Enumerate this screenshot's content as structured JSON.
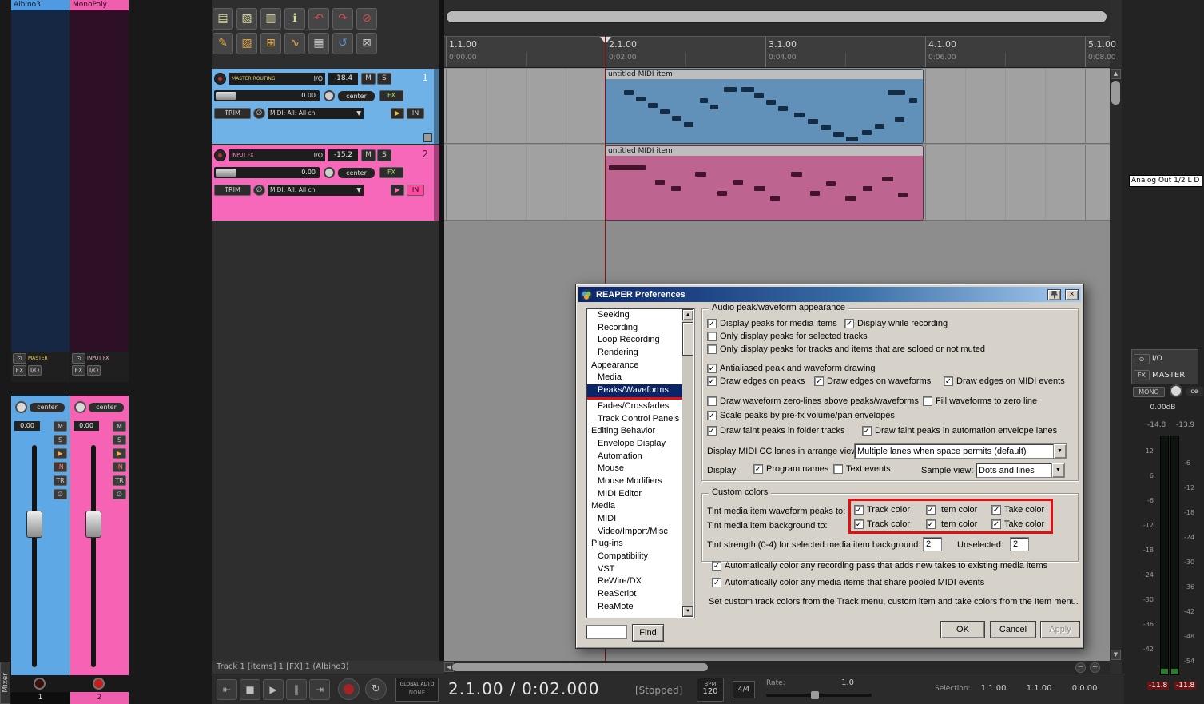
{
  "ui": {
    "mute": "M",
    "solo": "S",
    "fx": "FX",
    "io": "I/O",
    "trim": "TRIM",
    "in": "IN",
    "tr": "TR",
    "phase": "∅",
    "power": "⊙",
    "play": "▶",
    "mono": "MONO",
    "master": "MASTER",
    "mixer_tab": "Mixer",
    "up": "▲",
    "down": "▼",
    "left": "◀",
    "dd": "▼",
    "close": "×",
    "repeat": "↻",
    "zoom_in": "+",
    "zoom_out": "−"
  },
  "mixer": {
    "channels": [
      {
        "name": "Albino3",
        "number": "1",
        "volume": "0.00",
        "pan": "center",
        "route": "MASTER"
      },
      {
        "name": "MonoPoly",
        "number": "2",
        "volume": "0.00",
        "pan": "center",
        "route": "INPUT FX"
      }
    ]
  },
  "toolbar": {
    "row1": [
      {
        "name": "new-project-icon",
        "glyph": "▤",
        "color": "#d8d8a0"
      },
      {
        "name": "open-project-icon",
        "glyph": "▧",
        "color": "#d8d8a0"
      },
      {
        "name": "save-project-icon",
        "glyph": "▥",
        "color": "#d8d8a0"
      },
      {
        "name": "project-settings-icon",
        "glyph": "ℹ",
        "color": "#d8d8a0"
      },
      {
        "name": "undo-icon",
        "glyph": "↶",
        "color": "#d05050"
      },
      {
        "name": "redo-icon",
        "glyph": "↷",
        "color": "#d05050"
      },
      {
        "name": "clear-icon",
        "glyph": "⊘",
        "color": "#d05050"
      }
    ],
    "row2": [
      {
        "name": "pencil-draw-icon",
        "glyph": "✎",
        "color": "#e0a840"
      },
      {
        "name": "crossfade-icon",
        "glyph": "▨",
        "color": "#e0a840"
      },
      {
        "name": "grouping-icon",
        "glyph": "⊞",
        "color": "#e0a840"
      },
      {
        "name": "envelope-icon",
        "glyph": "∿",
        "color": "#e0a840"
      },
      {
        "name": "grid-icon",
        "glyph": "▦",
        "color": "#c8c8c8"
      },
      {
        "name": "undo-history-icon",
        "glyph": "↺",
        "color": "#6090d0"
      },
      {
        "name": "lock-icon",
        "glyph": "⊠",
        "color": "#c8c8c8"
      }
    ]
  },
  "tcp": {
    "tracks": [
      {
        "number": "1",
        "route_label": "MASTER ROUTING",
        "peak": "-18.4",
        "volume": "0.00",
        "pan": "center",
        "midi_input": "MIDI: All: All ch"
      },
      {
        "number": "2",
        "route_label": "INPUT FX",
        "peak": "-15.2",
        "volume": "0.00",
        "pan": "center",
        "midi_input": "MIDI: All: All ch"
      }
    ]
  },
  "ruler": {
    "marks": [
      {
        "bar": "1.1.00",
        "time": "0:00.00"
      },
      {
        "bar": "2.1.00",
        "time": "0:02.00"
      },
      {
        "bar": "3.1.00",
        "time": "0:04.00"
      },
      {
        "bar": "4.1.00",
        "time": "0:06.00"
      },
      {
        "bar": "5.1.00",
        "time": "0:08.00"
      }
    ]
  },
  "arrange": {
    "items": [
      {
        "label": "untitled MIDI item",
        "notes": [
          [
            23,
            14,
            12
          ],
          [
            38,
            22,
            12
          ],
          [
            53,
            30,
            12
          ],
          [
            68,
            38,
            12
          ],
          [
            83,
            46,
            12
          ],
          [
            98,
            54,
            12
          ],
          [
            118,
            24,
            10
          ],
          [
            131,
            32,
            10
          ],
          [
            148,
            10,
            16
          ],
          [
            170,
            10,
            16
          ],
          [
            186,
            18,
            12
          ],
          [
            201,
            26,
            12
          ],
          [
            216,
            34,
            12
          ],
          [
            236,
            42,
            13
          ],
          [
            253,
            50,
            13
          ],
          [
            269,
            58,
            13
          ],
          [
            285,
            66,
            13
          ],
          [
            301,
            72,
            15
          ],
          [
            321,
            64,
            12
          ],
          [
            337,
            56,
            12
          ],
          [
            353,
            14,
            22
          ],
          [
            362,
            48,
            12
          ],
          [
            380,
            24,
            10
          ]
        ]
      },
      {
        "label": "untitled MIDI item",
        "notes": [
          [
            4,
            12,
            46
          ],
          [
            62,
            30,
            12
          ],
          [
            82,
            38,
            12
          ],
          [
            112,
            20,
            14
          ],
          [
            140,
            44,
            12
          ],
          [
            160,
            30,
            12
          ],
          [
            186,
            38,
            14
          ],
          [
            206,
            50,
            12
          ],
          [
            232,
            20,
            14
          ],
          [
            256,
            44,
            12
          ],
          [
            276,
            32,
            12
          ],
          [
            300,
            50,
            14
          ],
          [
            322,
            38,
            12
          ],
          [
            346,
            26,
            14
          ],
          [
            366,
            46,
            12
          ]
        ]
      }
    ]
  },
  "status_bar": {
    "text": "Track 1 [items] 1 [FX] 1 (Albino3)"
  },
  "preferences": {
    "title": "REAPER Preferences",
    "tree": [
      {
        "label": "Seeking",
        "indent": 1
      },
      {
        "label": "Recording",
        "indent": 1
      },
      {
        "label": "Loop Recording",
        "indent": 1
      },
      {
        "label": "Rendering",
        "indent": 1
      },
      {
        "label": "Appearance",
        "indent": 0
      },
      {
        "label": "Media",
        "indent": 1
      },
      {
        "label": "Peaks/Waveforms",
        "indent": 1,
        "selected": true,
        "underlined": true
      },
      {
        "label": "Fades/Crossfades",
        "indent": 1
      },
      {
        "label": "Track Control Panels",
        "indent": 1
      },
      {
        "label": "Editing Behavior",
        "indent": 0
      },
      {
        "label": "Envelope Display",
        "indent": 1
      },
      {
        "label": "Automation",
        "indent": 1
      },
      {
        "label": "Mouse",
        "indent": 1
      },
      {
        "label": "Mouse Modifiers",
        "indent": 1
      },
      {
        "label": "MIDI Editor",
        "indent": 1
      },
      {
        "label": "Media",
        "indent": 0
      },
      {
        "label": "MIDI",
        "indent": 1
      },
      {
        "label": "Video/Import/Misc",
        "indent": 1
      },
      {
        "label": "Plug-ins",
        "indent": 0
      },
      {
        "label": "Compatibility",
        "indent": 1
      },
      {
        "label": "VST",
        "indent": 1
      },
      {
        "label": "ReWire/DX",
        "indent": 1
      },
      {
        "label": "ReaScript",
        "indent": 1
      },
      {
        "label": "ReaMote",
        "indent": 1
      }
    ],
    "find_label": "Find",
    "find_value": "",
    "appearance": {
      "title": "Audio peak/waveform appearance",
      "cb_display_peaks": {
        "label": "Display peaks for media items",
        "checked": true
      },
      "cb_display_while_recording": {
        "label": "Display while recording",
        "checked": true
      },
      "cb_only_selected": {
        "label": "Only display peaks for selected tracks",
        "checked": false
      },
      "cb_only_soloed": {
        "label": "Only display peaks for tracks and items that are soloed or not muted",
        "checked": false
      },
      "cb_antialiased": {
        "label": "Antialiased peak and waveform drawing",
        "checked": true
      },
      "cb_edges_peaks": {
        "label": "Draw edges on peaks",
        "checked": true
      },
      "cb_edges_waveforms": {
        "label": "Draw edges on waveforms",
        "checked": true
      },
      "cb_edges_midi": {
        "label": "Draw edges on MIDI events",
        "checked": true
      },
      "cb_zero_lines": {
        "label": "Draw waveform zero-lines above peaks/waveforms",
        "checked": false
      },
      "cb_fill_zero": {
        "label": "Fill waveforms to zero line",
        "checked": false
      },
      "cb_scale_prefx": {
        "label": "Scale peaks by pre-fx volume/pan envelopes",
        "checked": true
      },
      "cb_faint_folder": {
        "label": "Draw faint peaks in folder tracks",
        "checked": true
      },
      "cb_faint_envelope": {
        "label": "Draw faint peaks in automation envelope lanes",
        "checked": true
      },
      "midi_cc_label": "Display MIDI CC lanes in arrange view:",
      "midi_cc_value": "Multiple lanes when space permits (default)",
      "display_label": "Display",
      "cb_program_names": {
        "label": "Program names",
        "checked": true
      },
      "cb_text_events": {
        "label": "Text events",
        "checked": false
      },
      "sample_view_label": "Sample view:",
      "sample_view_value": "Dots and lines"
    },
    "custom_colors": {
      "title": "Custom colors",
      "tint_peaks_label": "Tint media item waveform peaks to:",
      "tint_bg_label": "Tint media item background to:",
      "peaks_track": {
        "label": "Track color",
        "checked": true
      },
      "peaks_item": {
        "label": "Item color",
        "checked": true
      },
      "peaks_take": {
        "label": "Take color",
        "checked": true
      },
      "bg_track": {
        "label": "Track color",
        "checked": true
      },
      "bg_item": {
        "label": "Item color",
        "checked": true
      },
      "bg_take": {
        "label": "Take color",
        "checked": true
      },
      "strength_label": "Tint strength (0-4) for selected media item background:",
      "strength_value": "2",
      "unselected_label": "Unselected:",
      "unselected_value": "2"
    },
    "cb_auto_record_color": {
      "label": "Automatically color any recording pass that adds new takes to existing media items",
      "checked": true
    },
    "cb_auto_pooled_color": {
      "label": "Automatically color any media items that share pooled MIDI events",
      "checked": true
    },
    "footer_note": "Set custom track colors from the Track menu, custom item and take colors from the Item menu.",
    "ok": "OK",
    "cancel": "Cancel",
    "apply": "Apply"
  },
  "transport": {
    "buttons": [
      {
        "name": "go-to-start-button",
        "glyph": "⇤"
      },
      {
        "name": "stop-button",
        "glyph": "■"
      },
      {
        "name": "play-button",
        "glyph": "▶"
      },
      {
        "name": "pause-button",
        "glyph": "‖"
      },
      {
        "name": "go-to-end-button",
        "glyph": "⇥"
      }
    ],
    "global_auto": "GLOBAL AUTO",
    "auto_mode": "NONE",
    "time": "2.1.00 / 0:02.000",
    "status": "[Stopped]",
    "bpm_label": "BPM",
    "bpm": "120",
    "timesig": "4/4",
    "rate_label": "Rate:",
    "rate": "1.0",
    "selection_label": "Selection:",
    "sel_start": "1.1.00",
    "sel_end": "1.1.00",
    "sel_length": "0.0.00"
  },
  "master": {
    "tooltip": "Analog Out 1/2 L D",
    "db_label": "0.00dB",
    "peak_left": "-14.8",
    "peak_right": "-13.9",
    "clip_left": "-11.8",
    "clip_right": "-11.8",
    "pan": "ce",
    "scale_left": [
      "12",
      "6",
      "-6",
      "-12",
      "-18",
      "-24",
      "-30",
      "-36",
      "-42"
    ],
    "scale_right": [
      "-6",
      "-12",
      "-18",
      "-24",
      "-30",
      "-36",
      "-42",
      "-48",
      "-54"
    ]
  },
  "annotations": {
    "color": "#e01010"
  }
}
